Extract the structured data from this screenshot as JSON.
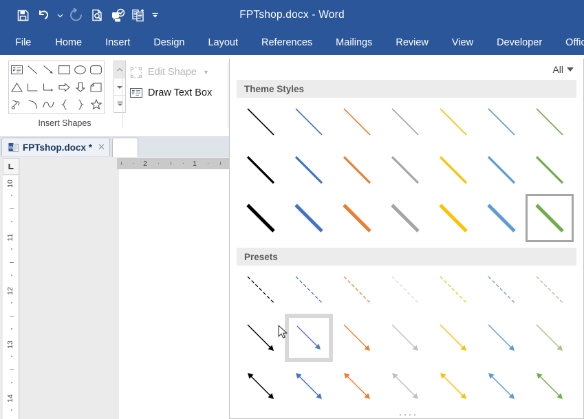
{
  "titlebar": {
    "title": "FPTshop.docx  -  Word",
    "quick_access": [
      {
        "name": "save-icon",
        "label": "Save",
        "enabled": true
      },
      {
        "name": "undo-icon",
        "label": "Undo",
        "enabled": true
      },
      {
        "name": "undo-dropdown-icon",
        "label": "Undo options",
        "enabled": true
      },
      {
        "name": "redo-icon",
        "label": "Redo",
        "enabled": false
      },
      {
        "name": "print-preview-icon",
        "label": "Print Preview and Print",
        "enabled": true
      },
      {
        "name": "spelling-grammar-icon",
        "label": "Spelling & Grammar",
        "enabled": true
      },
      {
        "name": "document-compare-icon",
        "label": "Compare Documents",
        "enabled": true
      },
      {
        "name": "customize-quick-access-icon",
        "label": "Customize Quick Access Toolbar",
        "enabled": true
      }
    ]
  },
  "ribbon": {
    "tabs": [
      {
        "label": "File"
      },
      {
        "label": "Home"
      },
      {
        "label": "Insert"
      },
      {
        "label": "Design"
      },
      {
        "label": "Layout"
      },
      {
        "label": "References"
      },
      {
        "label": "Mailings"
      },
      {
        "label": "Review"
      },
      {
        "label": "View"
      },
      {
        "label": "Developer"
      },
      {
        "label": "Office Tab"
      }
    ],
    "insert_shapes": {
      "group_label": "Insert Shapes",
      "shapes": [
        {
          "name": "text-box-shape"
        },
        {
          "name": "line-shape"
        },
        {
          "name": "line-arrow-shape"
        },
        {
          "name": "rectangle-shape"
        },
        {
          "name": "oval-shape"
        },
        {
          "name": "rounded-rectangle-shape"
        },
        {
          "name": "triangle-shape"
        },
        {
          "name": "elbow-connector-shape"
        },
        {
          "name": "elbow-arrow-connector-shape"
        },
        {
          "name": "right-arrow-shape"
        },
        {
          "name": "down-arrow-shape"
        },
        {
          "name": "folded-corner-shape"
        },
        {
          "name": "scribble-shape"
        },
        {
          "name": "arc-shape"
        },
        {
          "name": "curve-shape"
        },
        {
          "name": "left-brace-shape"
        },
        {
          "name": "right-brace-shape"
        },
        {
          "name": "star-shape"
        }
      ],
      "scroll_buttons": [
        {
          "name": "shapes-scroll-up-button"
        },
        {
          "name": "shapes-scroll-down-button"
        },
        {
          "name": "shapes-more-button"
        }
      ]
    },
    "edit_shape": {
      "label": "Edit Shape",
      "enabled": false,
      "has_dropdown": true
    },
    "draw_text_box": {
      "label": "Draw Text Box",
      "enabled": true
    }
  },
  "tabbar": {
    "document_tab": {
      "label": "FPTshop.docx *",
      "close_label": "✕"
    },
    "new_tab": {
      "label": ""
    }
  },
  "document": {
    "horizontal_ruler": {
      "labels": [
        "2",
        "1"
      ]
    },
    "vertical_ruler": {
      "labels": [
        "10",
        "11",
        "12",
        "13",
        "14"
      ]
    },
    "tab_stop_marker": "L"
  },
  "style_gallery": {
    "all_button": {
      "label": "All"
    },
    "sections": [
      {
        "title": "Theme Styles",
        "rows": [
          {
            "line_width": 1.6,
            "cells": [
              {
                "color": "#000000",
                "name": "theme-style-black-thin"
              },
              {
                "color": "#4472c4",
                "name": "theme-style-blue-thin"
              },
              {
                "color": "#ed7d31",
                "name": "theme-style-orange-thin"
              },
              {
                "color": "#a5a5a5",
                "name": "theme-style-gray-thin"
              },
              {
                "color": "#ffc000",
                "name": "theme-style-gold-thin"
              },
              {
                "color": "#5b9bd5",
                "name": "theme-style-lightblue-thin"
              },
              {
                "color": "#70ad47",
                "name": "theme-style-green-thin"
              }
            ]
          },
          {
            "line_width": 3.2,
            "cells": [
              {
                "color": "#000000",
                "name": "theme-style-black-medium"
              },
              {
                "color": "#4472c4",
                "name": "theme-style-blue-medium"
              },
              {
                "color": "#ed7d31",
                "name": "theme-style-orange-medium"
              },
              {
                "color": "#a5a5a5",
                "name": "theme-style-gray-medium"
              },
              {
                "color": "#ffc000",
                "name": "theme-style-gold-medium"
              },
              {
                "color": "#5b9bd5",
                "name": "theme-style-lightblue-medium"
              },
              {
                "color": "#70ad47",
                "name": "theme-style-green-medium"
              }
            ]
          },
          {
            "line_width": 5.0,
            "selected_index": 6,
            "cells": [
              {
                "color": "#000000",
                "name": "theme-style-black-thick"
              },
              {
                "color": "#4472c4",
                "name": "theme-style-blue-thick"
              },
              {
                "color": "#ed7d31",
                "name": "theme-style-orange-thick"
              },
              {
                "color": "#a5a5a5",
                "name": "theme-style-gray-thick"
              },
              {
                "color": "#ffc000",
                "name": "theme-style-gold-thick"
              },
              {
                "color": "#5b9bd5",
                "name": "theme-style-lightblue-thick"
              },
              {
                "color": "#70ad47",
                "name": "theme-style-green-thick"
              }
            ]
          }
        ]
      },
      {
        "title": "Presets",
        "rows": [
          {
            "line_width": 1.3,
            "style": "dashed",
            "cells": [
              {
                "color": "#000000",
                "name": "preset-black-dashed"
              },
              {
                "color": "#4472c4",
                "name": "preset-blue-dashed"
              },
              {
                "color": "#ed7d31",
                "name": "preset-orange-dashed"
              },
              {
                "color": "#d9d9d9",
                "name": "preset-gray-dashed"
              },
              {
                "color": "#ffc000",
                "name": "preset-gold-dashed"
              },
              {
                "color": "#5b9bd5",
                "name": "preset-lightblue-dashed"
              },
              {
                "color": "#a9c47f",
                "name": "preset-green-dashed"
              }
            ]
          },
          {
            "line_width": 1.3,
            "style": "arrow-end",
            "hover_index": 1,
            "cells": [
              {
                "color": "#000000",
                "name": "preset-black-arrow"
              },
              {
                "color": "#6a6ae0",
                "name": "preset-blue-arrow"
              },
              {
                "color": "#ed7d31",
                "name": "preset-orange-arrow"
              },
              {
                "color": "#bfbfbf",
                "name": "preset-gray-arrow"
              },
              {
                "color": "#ffc000",
                "name": "preset-gold-arrow"
              },
              {
                "color": "#5b9bd5",
                "name": "preset-lightblue-arrow"
              },
              {
                "color": "#a9c47f",
                "name": "preset-green-arrow"
              }
            ]
          },
          {
            "line_width": 1.5,
            "style": "arrow-both",
            "cells": [
              {
                "color": "#000000",
                "name": "preset-black-double-arrow"
              },
              {
                "color": "#4472c4",
                "name": "preset-blue-double-arrow"
              },
              {
                "color": "#ed7d31",
                "name": "preset-orange-double-arrow"
              },
              {
                "color": "#bfbfbf",
                "name": "preset-gray-double-arrow"
              },
              {
                "color": "#ffc000",
                "name": "preset-gold-double-arrow"
              },
              {
                "color": "#5b9bd5",
                "name": "preset-lightblue-double-arrow"
              },
              {
                "color": "#70ad47",
                "name": "preset-green-double-arrow"
              }
            ]
          }
        ]
      }
    ],
    "grip": {
      "name": "resize-grip"
    }
  },
  "colors": {
    "ribbon_blue": "#2b579a",
    "panel_border": "#c6c6c6",
    "section_header_bg": "#ececec",
    "selection_border": "#a6a6a6",
    "hover_bg": "#d8d8d8"
  }
}
